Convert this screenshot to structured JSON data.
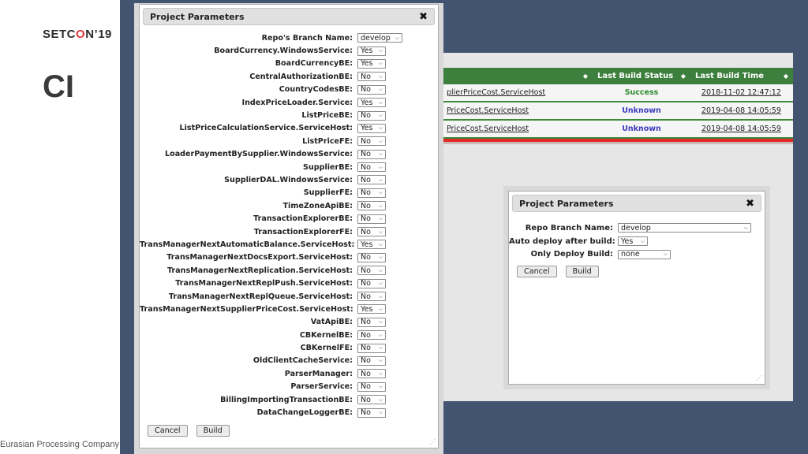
{
  "slide": {
    "logo_prefix": "SETC",
    "logo_o": "O",
    "logo_suffix": "N",
    "logo_mark": "’",
    "logo_year": "19",
    "title": "CI",
    "footer": "Eurasian Processing Company"
  },
  "project_list": {
    "headers": [
      "",
      "Last Build Status",
      "Last Build Time"
    ],
    "sort_icon": "sort-arrows-icon",
    "rows": [
      {
        "name": "plierPriceCost.ServiceHost",
        "status": "Success",
        "time": "2018-11-02 12:47:12"
      },
      {
        "name": "PriceCost.ServiceHost",
        "status": "Unknown",
        "time": "2019-04-08 14:05:59"
      },
      {
        "name": "PriceCost.ServiceHost",
        "status": "Unknown",
        "time": "2019-04-08 14:05:59"
      }
    ],
    "colors": {
      "header": "#3d7f3d",
      "success": "#2e8b2e",
      "unknown": "#3b3bbf",
      "alert_bar": "#e52929"
    }
  },
  "dialog_left": {
    "title": "Project Parameters",
    "close_label": "✖",
    "params": [
      {
        "label": "Repo's Branch Name:",
        "value": "develop"
      },
      {
        "label": "BoardCurrency.WindowsService:",
        "value": "Yes"
      },
      {
        "label": "BoardCurrencyBE:",
        "value": "Yes"
      },
      {
        "label": "CentralAuthorizationBE:",
        "value": "No"
      },
      {
        "label": "CountryCodesBE:",
        "value": "No"
      },
      {
        "label": "IndexPriceLoader.Service:",
        "value": "Yes"
      },
      {
        "label": "ListPriceBE:",
        "value": "No"
      },
      {
        "label": "ListPriceCalculationService.ServiceHost:",
        "value": "Yes"
      },
      {
        "label": "ListPriceFE:",
        "value": "No"
      },
      {
        "label": "LoaderPaymentBySupplier.WindowsService:",
        "value": "No"
      },
      {
        "label": "SupplierBE:",
        "value": "No"
      },
      {
        "label": "SupplierDAL.WindowsService:",
        "value": "No"
      },
      {
        "label": "SupplierFE:",
        "value": "No"
      },
      {
        "label": "TimeZoneApiBE:",
        "value": "No"
      },
      {
        "label": "TransactionExplorerBE:",
        "value": "No"
      },
      {
        "label": "TransactionExplorerFE:",
        "value": "No"
      },
      {
        "label": "TransManagerNextAutomaticBalance.ServiceHost:",
        "value": "Yes"
      },
      {
        "label": "TransManagerNextDocsExport.ServiceHost:",
        "value": "No"
      },
      {
        "label": "TransManagerNextReplication.ServiceHost:",
        "value": "No"
      },
      {
        "label": "TransManagerNextReplPush.ServiceHost:",
        "value": "No"
      },
      {
        "label": "TransManagerNextReplQueue.ServiceHost:",
        "value": "No"
      },
      {
        "label": "TransManagerNextSupplierPriceCost.ServiceHost:",
        "value": "Yes"
      },
      {
        "label": "VatApiBE:",
        "value": "No"
      },
      {
        "label": "CBKernelBE:",
        "value": "No"
      },
      {
        "label": "CBKernelFE:",
        "value": "No"
      },
      {
        "label": "OldClientCacheService:",
        "value": "No"
      },
      {
        "label": "ParserManager:",
        "value": "No"
      },
      {
        "label": "ParserService:",
        "value": "No"
      },
      {
        "label": "BillingImportingTransactionBE:",
        "value": "No"
      },
      {
        "label": "DataChangeLoggerBE:",
        "value": "No"
      }
    ],
    "cancel_label": "Cancel",
    "build_label": "Build"
  },
  "dialog_right": {
    "title": "Project Parameters",
    "close_label": "✖",
    "params": [
      {
        "label": "Repo Branch Name:",
        "value": "develop"
      },
      {
        "label": "Auto deploy after build:",
        "value": "Yes"
      },
      {
        "label": "Only Deploy Build:",
        "value": "none"
      }
    ],
    "cancel_label": "Cancel",
    "build_label": "Build"
  }
}
